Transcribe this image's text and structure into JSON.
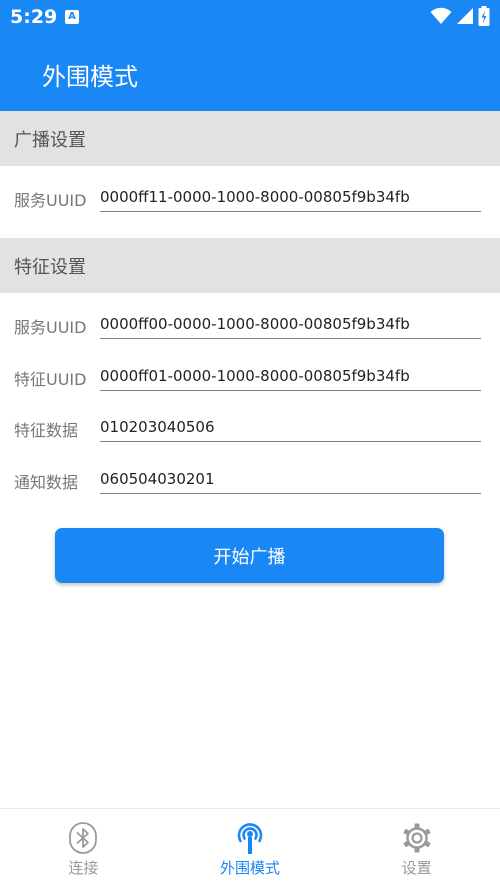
{
  "status": {
    "time": "5:29",
    "notification_letter": "A"
  },
  "app_bar": {
    "title": "外围模式"
  },
  "advertise_section": {
    "title": "广播设置",
    "service_uuid_label": "服务UUID",
    "service_uuid_value": "0000ff11-0000-1000-8000-00805f9b34fb"
  },
  "characteristic_section": {
    "title": "特征设置",
    "service_uuid_label": "服务UUID",
    "service_uuid_value": "0000ff00-0000-1000-8000-00805f9b34fb",
    "char_uuid_label": "特征UUID",
    "char_uuid_value": "0000ff01-0000-1000-8000-00805f9b34fb",
    "char_data_label": "特征数据",
    "char_data_value": "010203040506",
    "notify_data_label": "通知数据",
    "notify_data_value": "060504030201"
  },
  "start_button": {
    "label": "开始广播"
  },
  "bottom_nav": {
    "items": [
      {
        "label": "连接",
        "icon": "bluetooth-icon",
        "active": false
      },
      {
        "label": "外围模式",
        "icon": "broadcast-icon",
        "active": true
      },
      {
        "label": "设置",
        "icon": "gear-icon",
        "active": false
      }
    ]
  },
  "colors": {
    "primary": "#1a88f4",
    "section_bg": "#e2e2e2",
    "inactive": "#9a9a9a"
  }
}
